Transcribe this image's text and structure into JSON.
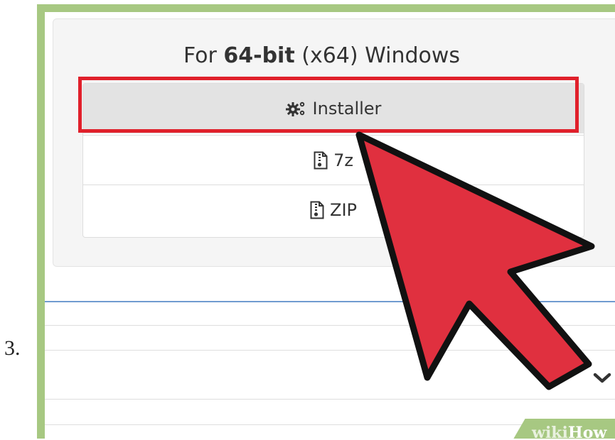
{
  "step": {
    "number": "3."
  },
  "panel": {
    "title_prefix": "For",
    "title_bold": "64-bit",
    "title_suffix": "(x64) Windows"
  },
  "downloads": [
    {
      "label": "Installer",
      "icon": "gears-icon",
      "highlighted": true
    },
    {
      "label": "7z",
      "icon": "archive-file-icon"
    },
    {
      "label": "ZIP",
      "icon": "archive-file-icon"
    }
  ],
  "watermark": {
    "wiki": "wiki",
    "how": "How"
  },
  "colors": {
    "frame_green": "#a7c882",
    "highlight_red": "#e0202b",
    "arrow_red": "#e0303f",
    "separator_blue": "#6f9bd0"
  },
  "icons": {
    "pointer": "pointer-arrow-icon",
    "chevron": "chevron-down-icon"
  }
}
